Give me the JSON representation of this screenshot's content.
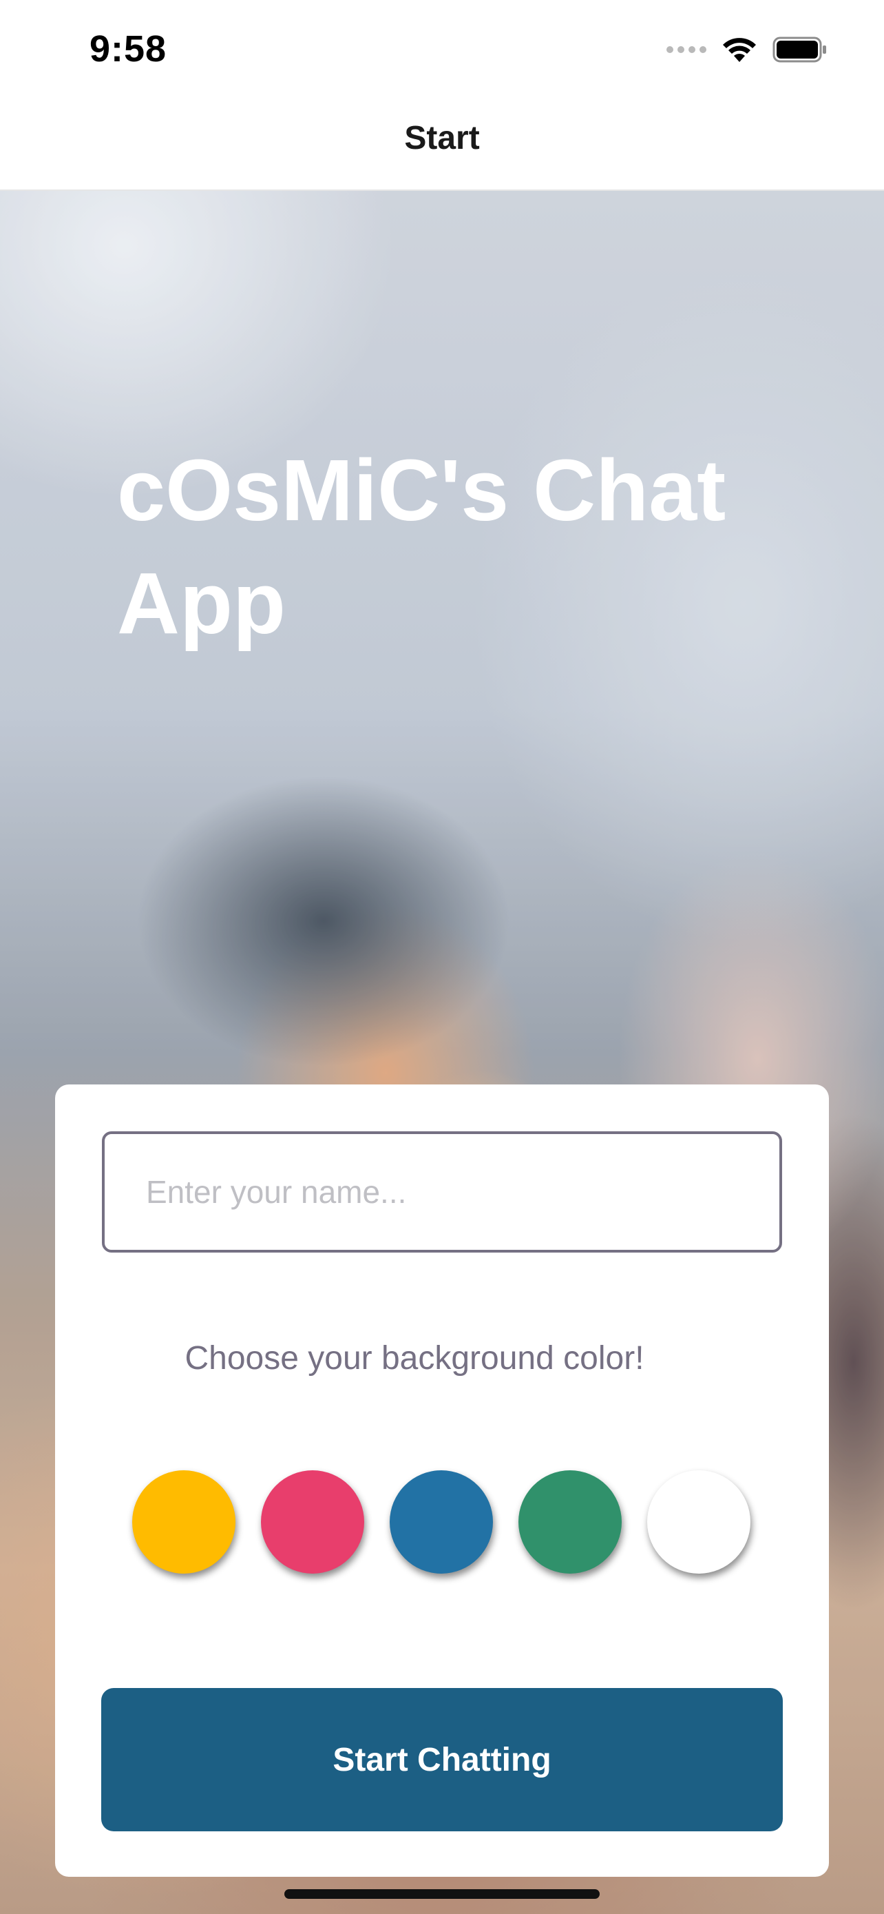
{
  "status_bar": {
    "time": "9:58",
    "icons": [
      "signal-dots-icon",
      "wifi-icon",
      "battery-icon"
    ]
  },
  "nav": {
    "title": "Start"
  },
  "main": {
    "title": "cOsMiC's Chat App",
    "name_input": {
      "placeholder": "Enter your name...",
      "value": ""
    },
    "color_prompt": "Choose your background color!",
    "color_options": [
      {
        "name": "yellow",
        "color": "#FFBB00"
      },
      {
        "name": "pink",
        "color": "#E83E6C"
      },
      {
        "name": "blue",
        "color": "#2272A5"
      },
      {
        "name": "green",
        "color": "#30916B"
      },
      {
        "name": "white",
        "color": "#FFFFFF"
      }
    ],
    "start_button": {
      "label": "Start Chatting",
      "color": "#1C5F84"
    }
  }
}
